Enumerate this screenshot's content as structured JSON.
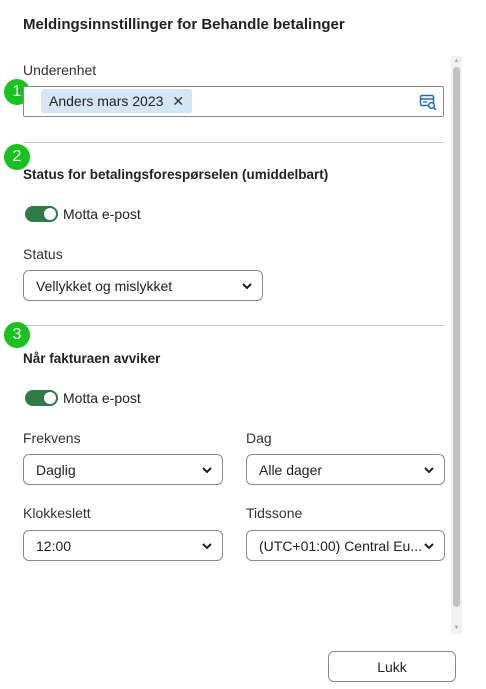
{
  "dialog": {
    "title": "Meldingsinnstillinger for Behandle betalinger",
    "close_label": "Lukk"
  },
  "steps": [
    "1",
    "2",
    "3"
  ],
  "subunit": {
    "label": "Underenhet",
    "selected_tag": "Anders mars 2023",
    "remove_icon": "close-icon",
    "lookup_icon": "search-lookup-icon"
  },
  "payment_status": {
    "title": "Status for betalingsforespørselen (umiddelbart)",
    "email_toggle_label": "Motta e-post",
    "email_enabled": true,
    "status_label": "Status",
    "status_value": "Vellykket og mislykket"
  },
  "invoice_deviation": {
    "title": "Når fakturaen avviker",
    "email_toggle_label": "Motta e-post",
    "email_enabled": true,
    "frequency_label": "Frekvens",
    "frequency_value": "Daglig",
    "day_label": "Dag",
    "day_value": "Alle dager",
    "time_label": "Klokkeslett",
    "time_value": "12:00",
    "timezone_label": "Tidssone",
    "timezone_value": "(UTC+01:00) Central Eu..."
  },
  "colors": {
    "badge": "#19c31d",
    "toggle_on": "#2f7a45",
    "chip_bg": "#d4e6f5",
    "lookup_icon": "#1f6fb2"
  }
}
